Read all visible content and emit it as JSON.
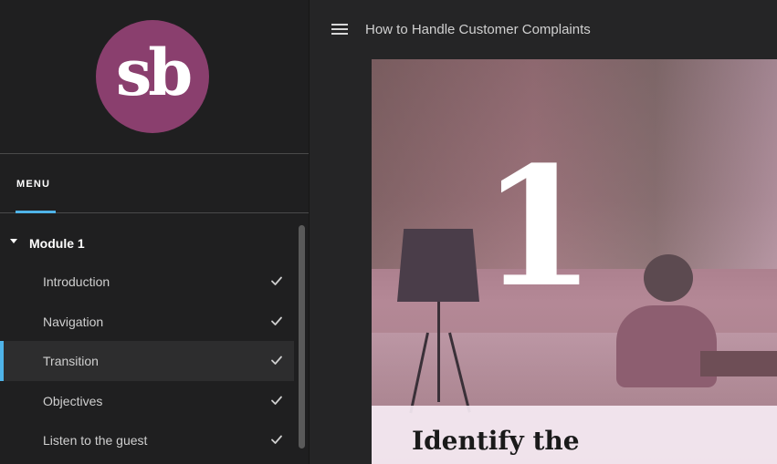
{
  "sidebar": {
    "logo_text": "sb",
    "menu_tab": "MENU",
    "module": {
      "title": "Module 1"
    },
    "lessons": [
      {
        "label": "Introduction",
        "completed": true
      },
      {
        "label": "Navigation",
        "completed": true
      },
      {
        "label": "Transition",
        "completed": true,
        "active": true
      },
      {
        "label": "Objectives",
        "completed": true
      },
      {
        "label": "Listen to the guest",
        "completed": true
      }
    ]
  },
  "header": {
    "menu_icon": "hamburger-icon",
    "course_title": "How to Handle Customer Complaints"
  },
  "hero": {
    "number": "1",
    "caption": "Identify the"
  },
  "colors": {
    "accent": "#4fb3e8",
    "logo_bg": "#8a3f6e",
    "sidebar_bg": "#1f1f20",
    "main_bg": "#252526"
  }
}
